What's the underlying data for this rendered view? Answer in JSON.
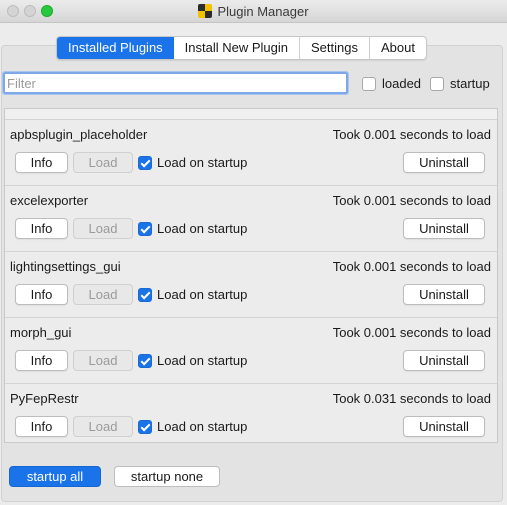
{
  "window": {
    "title": "Plugin Manager",
    "app_icon": "pymol-icon"
  },
  "tabs": [
    {
      "label": "Installed Plugins",
      "active": true
    },
    {
      "label": "Install New Plugin",
      "active": false
    },
    {
      "label": "Settings",
      "active": false
    },
    {
      "label": "About",
      "active": false
    }
  ],
  "filter": {
    "placeholder": "Filter",
    "value": ""
  },
  "filter_options": {
    "loaded_label": "loaded",
    "loaded_checked": false,
    "startup_label": "startup",
    "startup_checked": false
  },
  "plugins": [
    {
      "name": "apbsplugin_placeholder",
      "load_time": "Took 0.001 seconds to load",
      "info_label": "Info",
      "load_label": "Load",
      "load_enabled": false,
      "startup_label": "Load on startup",
      "startup_checked": true,
      "uninstall_label": "Uninstall"
    },
    {
      "name": "excelexporter",
      "load_time": "Took 0.001 seconds to load",
      "info_label": "Info",
      "load_label": "Load",
      "load_enabled": false,
      "startup_label": "Load on startup",
      "startup_checked": true,
      "uninstall_label": "Uninstall"
    },
    {
      "name": "lightingsettings_gui",
      "load_time": "Took 0.001 seconds to load",
      "info_label": "Info",
      "load_label": "Load",
      "load_enabled": false,
      "startup_label": "Load on startup",
      "startup_checked": true,
      "uninstall_label": "Uninstall"
    },
    {
      "name": "morph_gui",
      "load_time": "Took 0.001 seconds to load",
      "info_label": "Info",
      "load_label": "Load",
      "load_enabled": false,
      "startup_label": "Load on startup",
      "startup_checked": true,
      "uninstall_label": "Uninstall"
    },
    {
      "name": "PyFepRestr",
      "load_time": "Took 0.031 seconds to load",
      "info_label": "Info",
      "load_label": "Load",
      "load_enabled": false,
      "startup_label": "Load on startup",
      "startup_checked": true,
      "uninstall_label": "Uninstall"
    }
  ],
  "footer": {
    "startup_all_label": "startup all",
    "startup_none_label": "startup none"
  },
  "colors": {
    "accent": "#1a73e8",
    "window_bg": "#ececec"
  }
}
